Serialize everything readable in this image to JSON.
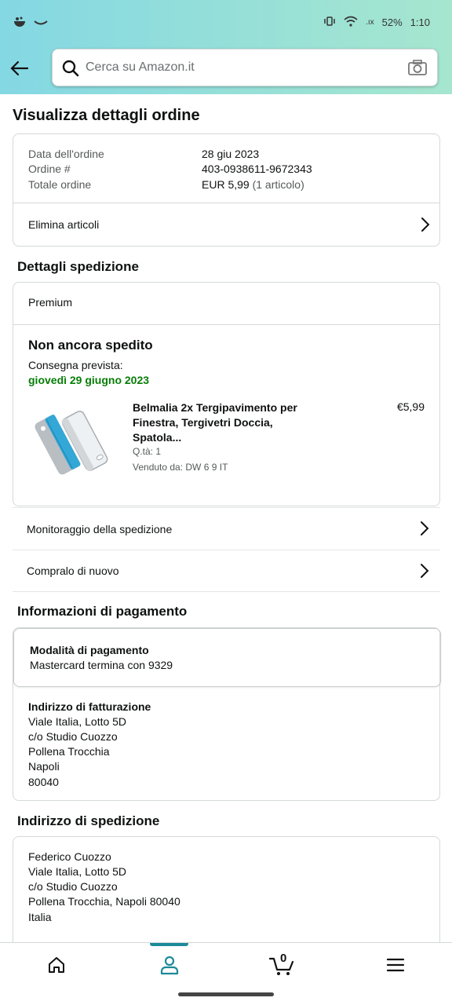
{
  "status_bar": {
    "battery": "52%",
    "time": "1:10",
    "network": ".ıx"
  },
  "search": {
    "placeholder": "Cerca su Amazon.it"
  },
  "page": {
    "title": "Visualizza dettagli ordine"
  },
  "order_summary": {
    "date_label": "Data dell'ordine",
    "date_value": "28 giu 2023",
    "number_label": "Ordine #",
    "number_value": "403-0938611-9672343",
    "total_label": "Totale ordine",
    "total_value": "EUR 5,99",
    "total_items": "(1 articolo)",
    "delete_items": "Elimina articoli"
  },
  "shipping_details": {
    "section_title": "Dettagli spedizione",
    "shipping_speed": "Premium",
    "status": "Non ancora spedito",
    "delivery_label": "Consegna prevista:",
    "delivery_date": "giovedì 29 giugno 2023",
    "product": {
      "title": "Belmalia 2x Tergipavimento per Finestra, Tergivetri Doccia, Spatola...",
      "price": "€5,99",
      "quantity": "Q.tà: 1",
      "seller": "Venduto da: DW 6 9 IT"
    },
    "track": "Monitoraggio della spedizione",
    "buy_again": "Compralo di nuovo"
  },
  "payment": {
    "section_title": "Informazioni di pagamento",
    "method_title": "Modalità di pagamento",
    "method_value": "Mastercard  termina con 9329",
    "billing_title": "Indirizzo di fatturazione",
    "billing_lines": [
      "Viale Italia, Lotto 5D",
      "c/o Studio Cuozzo",
      "Pollena Trocchia",
      "Napoli",
      "80040"
    ]
  },
  "shipping_address": {
    "section_title": "Indirizzo di spedizione",
    "lines": [
      "Federico Cuozzo",
      "Viale Italia, Lotto 5D",
      "c/o Studio Cuozzo",
      "Pollena Trocchia, Napoli 80040",
      "Italia"
    ]
  },
  "bottom_nav": {
    "cart_count": "0",
    "active": "account",
    "accent_color": "#1d8a99"
  },
  "colors": {
    "delivery_green": "#067d06",
    "header_gradient_start": "#84d8e3",
    "header_gradient_end": "#a6e6cf"
  }
}
